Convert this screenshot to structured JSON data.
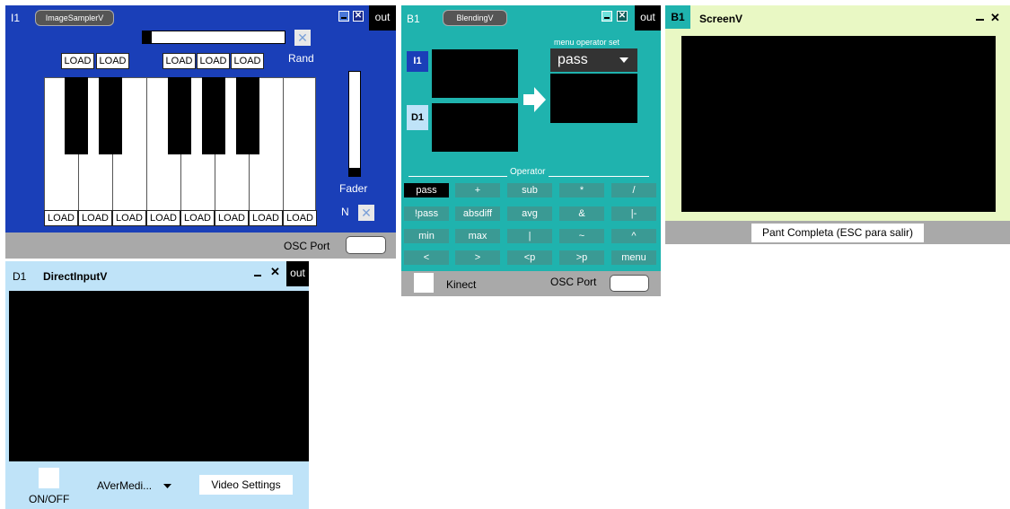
{
  "image_sampler": {
    "id": "I1",
    "title": "ImageSamplerV",
    "out_label": "out",
    "rand_label": "Rand",
    "fader_label": "Fader",
    "n_label": "N",
    "osc_label": "OSC Port",
    "top_load_labels": [
      "LOAD",
      "LOAD",
      "LOAD",
      "LOAD",
      "LOAD"
    ],
    "bottom_load_labels": [
      "LOAD",
      "LOAD",
      "LOAD",
      "LOAD",
      "LOAD",
      "LOAD",
      "LOAD",
      "LOAD"
    ],
    "colors": {
      "body": "#1a3fb8",
      "bar": "#a9a9a9"
    }
  },
  "blending": {
    "id": "B1",
    "title": "BlendingV",
    "out_label": "out",
    "input_i1": "I1",
    "input_d1": "D1",
    "menu_operator_label": "menu operator set",
    "selected_operator": "pass",
    "operator_heading": "Operator",
    "operators": [
      [
        "pass",
        "+",
        "sub",
        "*",
        "/"
      ],
      [
        "!pass",
        "absdiff",
        "avg",
        "&",
        "|-"
      ],
      [
        "min",
        "max",
        "|",
        "~",
        "^"
      ],
      [
        "<",
        ">",
        "<p",
        ">p",
        "menu"
      ]
    ],
    "kinect_label": "Kinect",
    "osc_label": "OSC Port",
    "colors": {
      "body": "#1fb3ae",
      "bar": "#a9a9a9"
    }
  },
  "screen": {
    "id": "B1",
    "title": "ScreenV",
    "fullscreen_label": "Pant Completa (ESC para salir)",
    "colors": {
      "body": "#e9f8c4",
      "bar": "#a9a9a9"
    }
  },
  "direct_input": {
    "id": "D1",
    "title": "DirectInputV",
    "out_label": "out",
    "on_off_label": "ON/OFF",
    "device_label": "AVerMedi...",
    "video_settings_label": "Video Settings",
    "colors": {
      "body": "#bfe3f8"
    }
  }
}
